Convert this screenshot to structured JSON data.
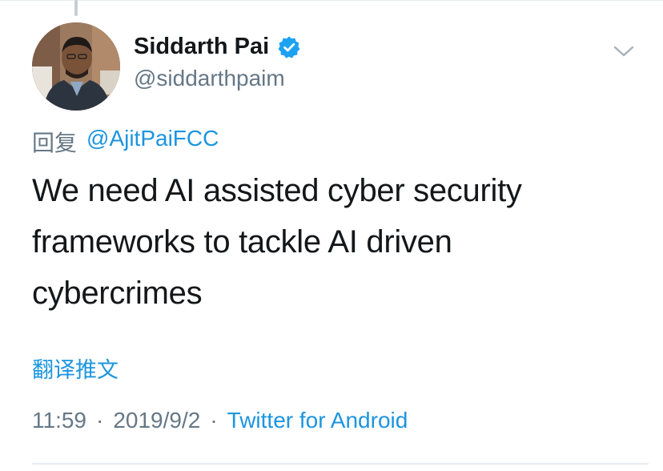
{
  "tweet": {
    "display_name": "Siddarth Pai",
    "handle": "@siddarthpaim",
    "reply_prefix": "回复",
    "reply_mention": "@AjitPaiFCC",
    "text_line1": "We need AI assisted cyber security",
    "text_line2": "frameworks to tackle AI driven",
    "text_line3": "cybercrimes",
    "translate_label": "翻译推文",
    "time": "11:59",
    "separator": "·",
    "date": "2019/9/2",
    "source": "Twitter for Android"
  },
  "icons": {
    "verified": "verified-badge-icon",
    "menu": "chevron-down-icon",
    "avatar": "profile-photo"
  },
  "colors": {
    "link": "#1b95e0",
    "text_primary": "#14171a",
    "text_secondary": "#657786",
    "verified": "#1da1f2"
  }
}
